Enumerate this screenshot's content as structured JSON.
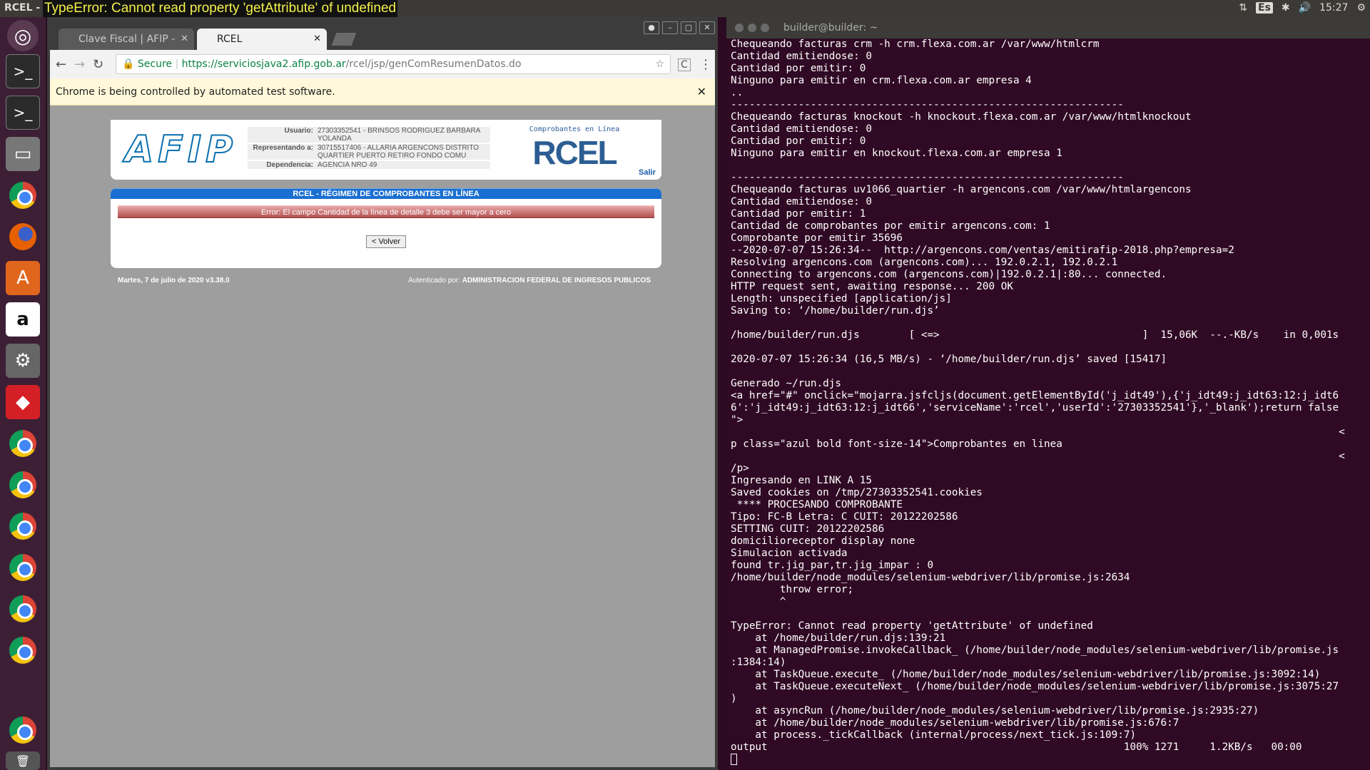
{
  "topbar": {
    "window_title": "RCEL - Google Chrome",
    "error_overlay": "TypeError: Cannot read property 'getAttribute' of undefined",
    "keyboard": "Es",
    "network_icon": "⇅",
    "bluetooth_icon": "✱",
    "volume_icon": "🔊",
    "time": "15:27",
    "settings_icon": "⚙"
  },
  "launcher": {
    "items": [
      "ubuntu-logo",
      "terminal",
      "terminal",
      "file-manager",
      "chrome",
      "firefox",
      "software-center",
      "amazon",
      "settings",
      "anydesk",
      "chrome",
      "chrome",
      "chrome",
      "chrome",
      "chrome",
      "chrome-stack",
      "chrome",
      "trash"
    ]
  },
  "browser": {
    "tabs": [
      {
        "label": "Clave Fiscal | AFIP -",
        "active": false
      },
      {
        "label": "RCEL",
        "active": true
      }
    ],
    "secure_label": "Secure",
    "url_host": "https://serviciosjava2.afip.gob.ar",
    "url_path": "/rcel/jsp/genComResumenDatos.do",
    "infobar": "Chrome is being controlled by automated test software.",
    "page": {
      "logo": "AFIP",
      "usuario_label": "Usuario:",
      "usuario_value": "27303352541 - BRINSOS RODRIGUEZ BARBARA YOLANDA",
      "representando_label": "Representando a:",
      "representando_value": "30715517406 - ALLARIA ARGENCONS DISTRITO QUARTIER PUERTO RETIRO FONDO COMU",
      "dependencia_label": "Dependencia:",
      "dependencia_value": "AGENCIA NRO 49",
      "rcel_caption": "Comprobantes en Línea",
      "rcel_logo": "RCEL",
      "salir": "Salir",
      "panel_title": "RCEL - RÉGIMEN DE COMPROBANTES EN LÍNEA",
      "error_message": "Error: El campo Cantidad de la línea de detalle 3 debe ser mayor a cero",
      "back_button": "< Volver",
      "footer_date": "Martes, 7 de julio de 2020 v3.38.0",
      "footer_auth_label": "Autenticado por:",
      "footer_auth_value": "ADMINISTRACION FEDERAL DE INGRESOS PUBLICOS"
    }
  },
  "terminal": {
    "title": "builder@builder: ~",
    "output": "Chequeando facturas crm -h crm.flexa.com.ar /var/www/htmlcrm\nCantidad emitiendose: 0\nCantidad por emitir: 0\nNinguno para emitir en crm.flexa.com.ar empresa 4\n..\n----------------------------------------------------------------\nChequeando facturas knockout -h knockout.flexa.com.ar /var/www/htmlknockout\nCantidad emitiendose: 0\nCantidad por emitir: 0\nNinguno para emitir en knockout.flexa.com.ar empresa 1\n\n----------------------------------------------------------------\nChequeando facturas uv1066_quartier -h argencons.com /var/www/htmlargencons\nCantidad emitiendose: 0\nCantidad por emitir: 1\nCantidad de comprobantes por emitir argencons.com: 1\nComprobante por emitir 35696\n--2020-07-07 15:26:34--  http://argencons.com/ventas/emitirafip-2018.php?empresa=2\nResolving argencons.com (argencons.com)... 192.0.2.1, 192.0.2.1\nConnecting to argencons.com (argencons.com)|192.0.2.1|:80... connected.\nHTTP request sent, awaiting response... 200 OK\nLength: unspecified [application/js]\nSaving to: ‘/home/builder/run.djs’\n\n/home/builder/run.djs        [ <=>                                 ]  15,06K  --.-KB/s    in 0,001s\n\n2020-07-07 15:26:34 (16,5 MB/s) - ‘/home/builder/run.djs’ saved [15417]\n\nGenerado ~/run.djs\n<a href=\"#\" onclick=\"mojarra.jsfcljs(document.getElementById('j_idt49'),{'j_idt49:j_idt63:12:j_idt6\n6':'j_idt49:j_idt63:12:j_idt66','serviceName':'rcel','userId':'27303352541'},'_blank');return false\n\">\n                                                                                                   <\np class=\"azul bold font-size-14\">Comprobantes en linea\n                                                                                                   <\n/p>\nIngresando en LINK A 15\nSaved cookies on /tmp/27303352541.cookies\n **** PROCESANDO COMPROBANTE\nTipo: FC-B Letra: C CUIT: 20122202586\nSETTING CUIT: 20122202586\ndomicilioreceptor display none\nSimulacion activada\nfound tr.jig_par,tr.jig_impar : 0\n/home/builder/node_modules/selenium-webdriver/lib/promise.js:2634\n        throw error;\n        ^\n\nTypeError: Cannot read property 'getAttribute' of undefined\n    at /home/builder/run.djs:139:21\n    at ManagedPromise.invokeCallback_ (/home/builder/node_modules/selenium-webdriver/lib/promise.js\n:1384:14)\n    at TaskQueue.execute_ (/home/builder/node_modules/selenium-webdriver/lib/promise.js:3092:14)\n    at TaskQueue.executeNext_ (/home/builder/node_modules/selenium-webdriver/lib/promise.js:3075:27\n)\n    at asyncRun (/home/builder/node_modules/selenium-webdriver/lib/promise.js:2935:27)\n    at /home/builder/node_modules/selenium-webdriver/lib/promise.js:676:7\n    at process._tickCallback (internal/process/next_tick.js:109:7)\noutput                                                          100% 1271     1.2KB/s   00:00"
  },
  "colors": {
    "terminal_bg": "#300a24",
    "launcher_bg": "#3d1f35",
    "afip_blue": "#1a6fd0",
    "error_red": "#b25050"
  }
}
